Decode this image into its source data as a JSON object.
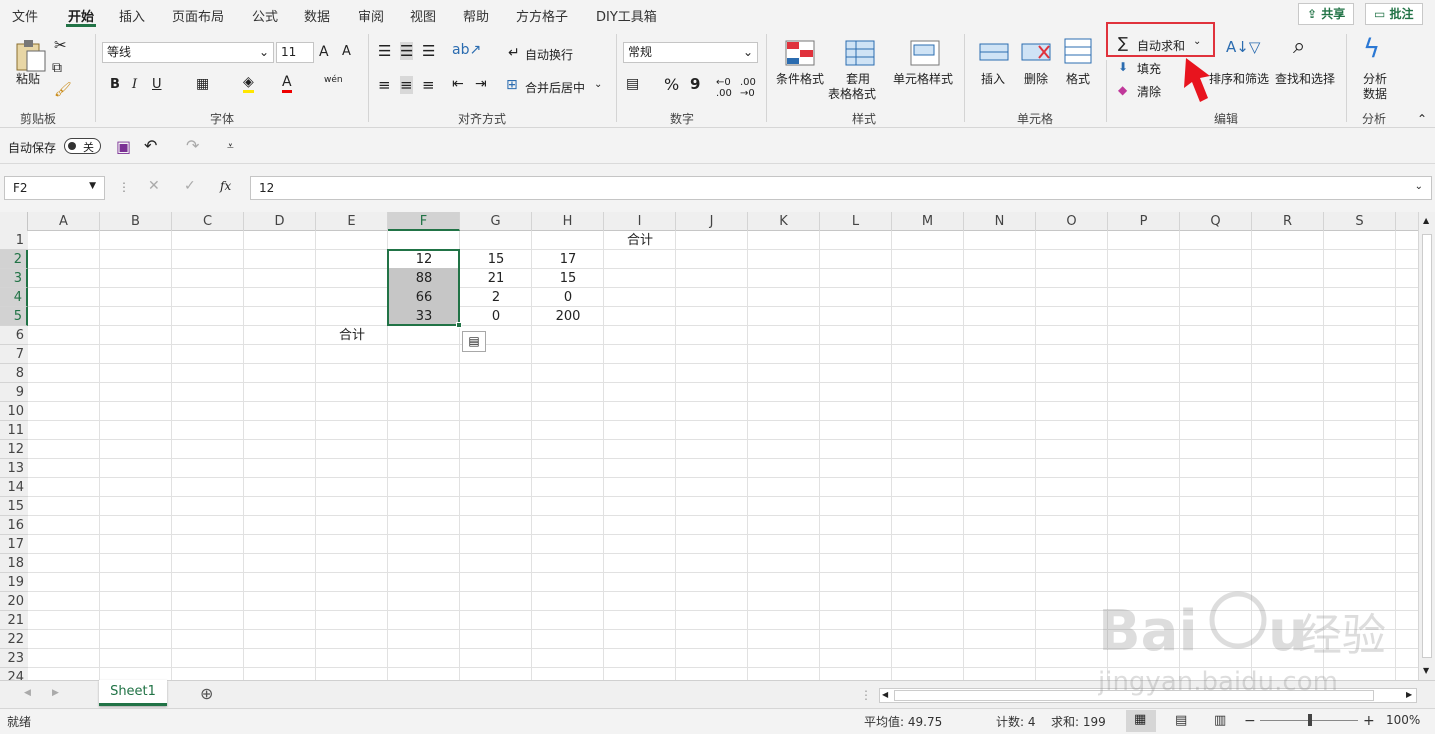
{
  "menu": [
    "文件",
    "开始",
    "插入",
    "页面布局",
    "公式",
    "数据",
    "审阅",
    "视图",
    "帮助",
    "方方格子",
    "DIY工具箱"
  ],
  "topright": {
    "share": "共享",
    "comment": "批注"
  },
  "ribbon": {
    "clipboard": {
      "paste": "粘贴",
      "label": "剪贴板"
    },
    "font": {
      "name": "等线",
      "size": "11",
      "label": "字体",
      "a_up": "A",
      "a_down": "A",
      "wen": "wén"
    },
    "align": {
      "wrap": "自动换行",
      "merge": "合并后居中",
      "label": "对齐方式"
    },
    "number": {
      "format": "常规",
      "label": "数字",
      "percent": "%",
      "comma": "9"
    },
    "styles": {
      "cond": "条件格式",
      "table1": "套用",
      "table2": "表格格式",
      "cellstyle": "单元格样式",
      "label": "样式"
    },
    "cells": {
      "insert": "插入",
      "delete": "删除",
      "format": "格式",
      "label": "单元格"
    },
    "editing": {
      "autosum": "自动求和",
      "fill": "填充",
      "clear": "清除",
      "sort": "排序和筛选",
      "find": "查找和选择",
      "label": "编辑"
    },
    "analysis": {
      "btn1": "分析",
      "btn2": "数据",
      "label": "分析"
    }
  },
  "qat": {
    "autosave": "自动保存",
    "toggle": "关"
  },
  "formula": {
    "namebox": "F2",
    "value": "12",
    "fx": "fx"
  },
  "columns": [
    "A",
    "B",
    "C",
    "D",
    "E",
    "F",
    "G",
    "H",
    "I",
    "J",
    "K",
    "L",
    "M",
    "N",
    "O",
    "P",
    "Q",
    "R",
    "S"
  ],
  "rows": [
    "1",
    "2",
    "3",
    "4",
    "5",
    "6",
    "7",
    "8",
    "9",
    "10",
    "11",
    "12",
    "13",
    "14",
    "15",
    "16",
    "17",
    "18",
    "19",
    "20",
    "21",
    "22",
    "23",
    "24"
  ],
  "cells": {
    "I1": "合计",
    "F2": "12",
    "G2": "15",
    "H2": "17",
    "F3": "88",
    "G3": "21",
    "H3": "15",
    "F4": "66",
    "G4": "2",
    "H4": "0",
    "F5": "33",
    "G5": "0",
    "H5": "200",
    "E6": "合计"
  },
  "sheet_tab": "Sheet1",
  "status": {
    "ready": "就绪",
    "avg": "平均值: 49.75",
    "count": "计数: 4",
    "sum": "求和: 199",
    "zoom": "100%"
  },
  "colors": {
    "accent": "#217346",
    "highlight": "#e0323c"
  }
}
